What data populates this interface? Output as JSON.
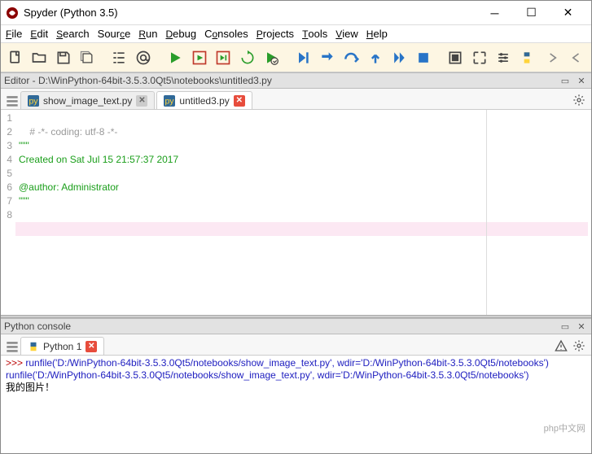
{
  "window": {
    "title": "Spyder (Python 3.5)"
  },
  "menu": {
    "file": "File",
    "edit": "Edit",
    "search": "Search",
    "source": "Source",
    "run": "Run",
    "debug": "Debug",
    "consoles": "Consoles",
    "projects": "Projects",
    "tools": "Tools",
    "view": "View",
    "help": "Help"
  },
  "editor_pane": {
    "title": "Editor - D:\\WinPython-64bit-3.5.3.0Qt5\\notebooks\\untitled3.py",
    "tabs": [
      {
        "label": "show_image_text.py",
        "modified": false
      },
      {
        "label": "untitled3.py",
        "modified": true
      }
    ],
    "code": {
      "lines": [
        {
          "n": "1",
          "cls": "c-comment",
          "text": "# -*- coding: utf-8 -*-"
        },
        {
          "n": "2",
          "cls": "c-string",
          "text": "\"\"\""
        },
        {
          "n": "3",
          "cls": "c-string",
          "text": "Created on Sat Jul 15 21:57:37 2017"
        },
        {
          "n": "4",
          "cls": "c-string",
          "text": ""
        },
        {
          "n": "5",
          "cls": "c-string",
          "text": "@author: Administrator"
        },
        {
          "n": "6",
          "cls": "c-string",
          "text": "\"\"\""
        },
        {
          "n": "7",
          "cls": "",
          "text": ""
        },
        {
          "n": "8",
          "cls": "c-current",
          "text": " "
        }
      ]
    }
  },
  "console_pane": {
    "title": "Python console",
    "tab": "Python 1",
    "output": {
      "l1a": ">>> ",
      "l1b": "runfile('D:/WinPython-64bit-3.5.3.0Qt5/notebooks/show_image_text.py', wdir='D:/WinPython-64bit-3.5.3.0Qt5/notebooks')",
      "l2": "runfile('D:/WinPython-64bit-3.5.3.0Qt5/notebooks/show_image_text.py', wdir='D:/WinPython-64bit-3.5.3.0Qt5/notebooks')",
      "l3": "我的图片！"
    }
  },
  "watermark": "php中文网"
}
